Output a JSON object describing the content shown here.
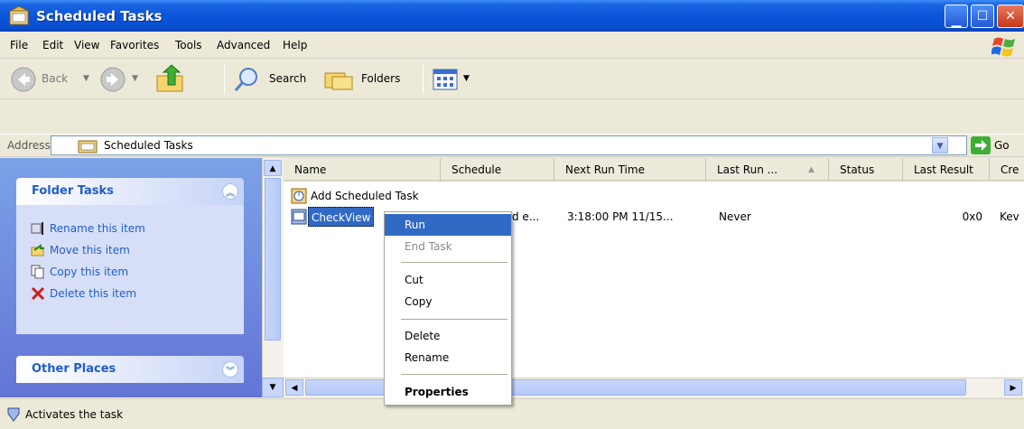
{
  "window": {
    "title": "Scheduled Tasks"
  },
  "menu": [
    "File",
    "Edit",
    "View",
    "Favorites",
    "Tools",
    "Advanced",
    "Help"
  ],
  "toolbar": {
    "back_label": "Back",
    "search_label": "Search",
    "folders_label": "Folders"
  },
  "address": {
    "label": "Address",
    "value": "Scheduled Tasks",
    "go_label": "Go"
  },
  "folder_tasks": {
    "title": "Folder Tasks",
    "items": [
      "Rename this item",
      "Move this item",
      "Copy this item",
      "Delete this item"
    ]
  },
  "other_places": {
    "title": "Other Places"
  },
  "columns": [
    "Name",
    "Schedule",
    "Next Run Time",
    "Last Run ...",
    "Status",
    "Last Result",
    "Cre"
  ],
  "rows": [
    {
      "name": "Add Scheduled Task",
      "schedule": "",
      "next_run": "",
      "last_run": "",
      "status": "",
      "last_result": "",
      "creator": ""
    },
    {
      "name": "CheckView",
      "schedule": "d e...",
      "next_run": "3:18:00 PM 11/15...",
      "last_run": "Never",
      "status": "",
      "last_result": "0x0",
      "creator": "Kev"
    }
  ],
  "context_menu": {
    "run": "Run",
    "end_task": "End Task",
    "cut": "Cut",
    "copy": "Copy",
    "delete": "Delete",
    "rename": "Rename",
    "properties": "Properties"
  },
  "status_bar": {
    "text": "Activates the task"
  },
  "colors": {
    "title_blue": "#0a55da",
    "selection": "#316ac5",
    "task_link": "#215dc6"
  }
}
